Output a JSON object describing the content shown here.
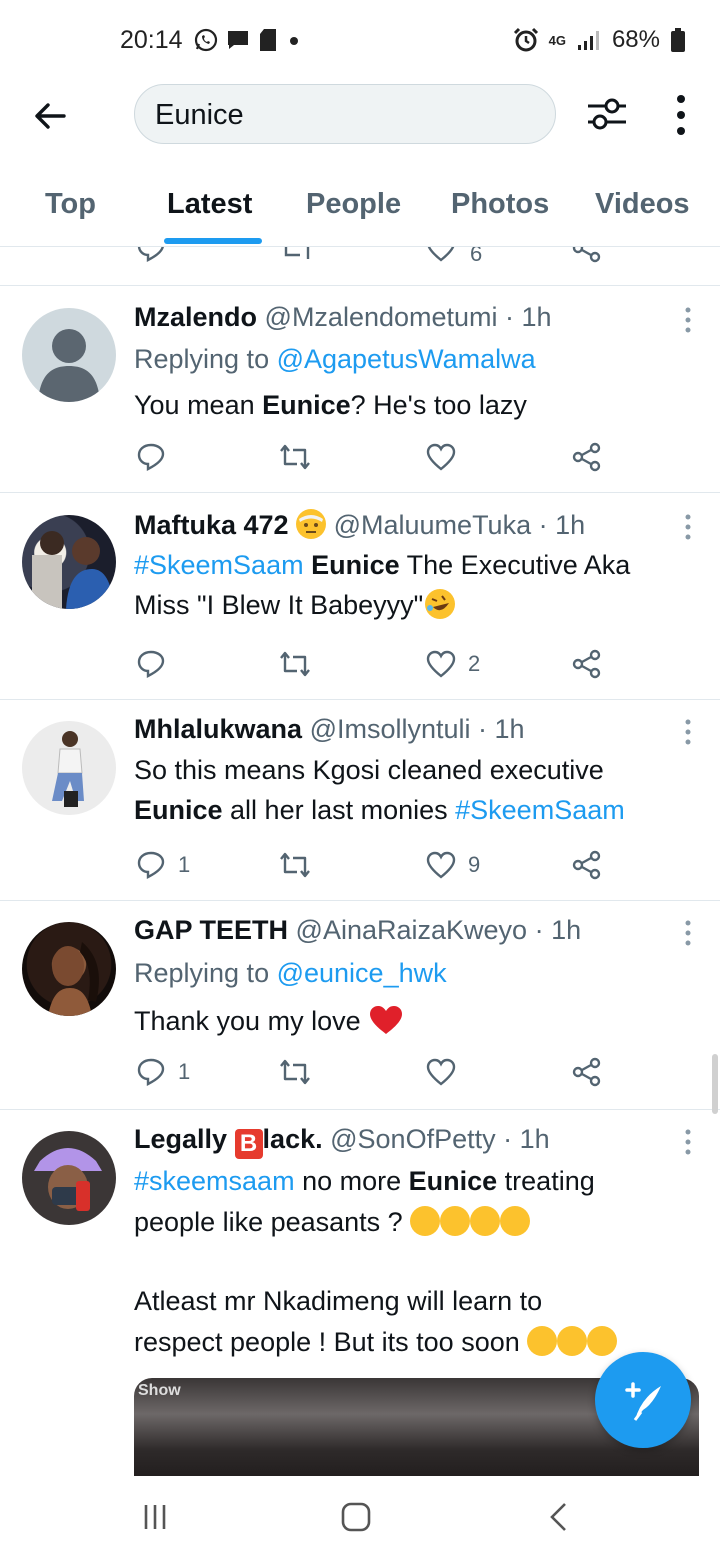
{
  "status_bar": {
    "time": "20:14",
    "network": "4G",
    "battery": "68%"
  },
  "search": {
    "query": "Eunice"
  },
  "tabs": [
    {
      "label": "Top"
    },
    {
      "label": "Latest"
    },
    {
      "label": "People"
    },
    {
      "label": "Photos"
    },
    {
      "label": "Videos"
    }
  ],
  "active_tab": "Latest",
  "partial_tweet": {
    "likes": "6"
  },
  "tweets": [
    {
      "name": "Mzalendo",
      "handle": "@Mzalendometumi",
      "time": "· 1h",
      "reply_prefix": "Replying to ",
      "reply_to": "@AgapetusWamalwa",
      "text_a": "You mean ",
      "text_b": "Eunice",
      "text_c": "? He's too lazy",
      "replies": "",
      "retweets": "",
      "likes": ""
    },
    {
      "name": "Maftuka 472",
      "handle": "@MaluumeTuka",
      "time": "· 1h",
      "text_hash": "#SkeemSaam",
      "text_bold": "Eunice",
      "text_rest": " The Executive Aka",
      "text_line2": "Miss \"I Blew It Babeyyy\"",
      "replies": "",
      "retweets": "",
      "likes": "2"
    },
    {
      "name": "Mhlalukwana",
      "handle": "@Imsollyntuli",
      "time": "· 1h",
      "text_line1": "So this means Kgosi cleaned executive",
      "text_bold": "Eunice",
      "text_mid": " all her last monies ",
      "text_hash": "#SkeemSaam",
      "replies": "1",
      "retweets": "",
      "likes": "9"
    },
    {
      "name": "GAP TEETH",
      "handle": "@AinaRaizaKweyo",
      "time": "· 1h",
      "reply_prefix": "Replying to ",
      "reply_to": "@eunice_hwk",
      "text_line1": "Thank you my love",
      "replies": "1",
      "retweets": "",
      "likes": ""
    },
    {
      "name_a": "Legally ",
      "name_b": "B",
      "name_c": "lack.",
      "handle": "@SonOfPetty",
      "time": "· 1h",
      "text_hash": "#skeemsaam",
      "text_mid": " no more ",
      "text_bold": "Eunice",
      "text_rest": " treating",
      "text_line2": "people like peasants ?",
      "text_line3": "Atleast mr Nkadimeng will learn to",
      "text_line4": "respect people ! But its too soon",
      "media_label": "Show"
    }
  ],
  "colors": {
    "accent": "#1d9bf0",
    "text": "#0f1419",
    "muted": "#536471",
    "divider": "#e1e8ed"
  },
  "icons": [
    "back-arrow-icon",
    "search-filter-icon",
    "more-vert-icon",
    "reply-icon",
    "retweet-icon",
    "like-icon",
    "share-icon",
    "compose-tweet-icon"
  ]
}
